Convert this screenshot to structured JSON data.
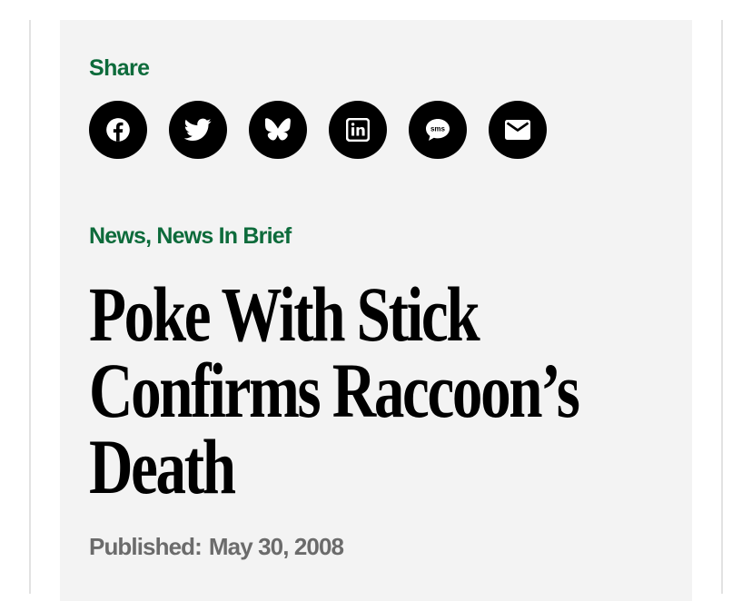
{
  "share": {
    "label": "Share",
    "buttons": [
      {
        "name": "facebook",
        "icon": "facebook-icon"
      },
      {
        "name": "twitter",
        "icon": "twitter-icon"
      },
      {
        "name": "bluesky",
        "icon": "bluesky-icon"
      },
      {
        "name": "linkedin",
        "icon": "linkedin-icon"
      },
      {
        "name": "sms",
        "icon": "sms-icon",
        "icon_text": "sms"
      },
      {
        "name": "email",
        "icon": "email-icon"
      }
    ]
  },
  "article": {
    "categories": [
      {
        "label": "News",
        "separator": ", "
      },
      {
        "label": "News In Brief",
        "separator": ""
      }
    ],
    "title": "Poke With Stick Confirms Raccoon’s Death",
    "published_label": "Published:",
    "published_date": "May 30, 2008"
  },
  "colors": {
    "accent_green": "#0d6b3b",
    "card_background": "#f3f3f3",
    "button_background": "#000000",
    "meta_gray": "#6b6b6b"
  }
}
